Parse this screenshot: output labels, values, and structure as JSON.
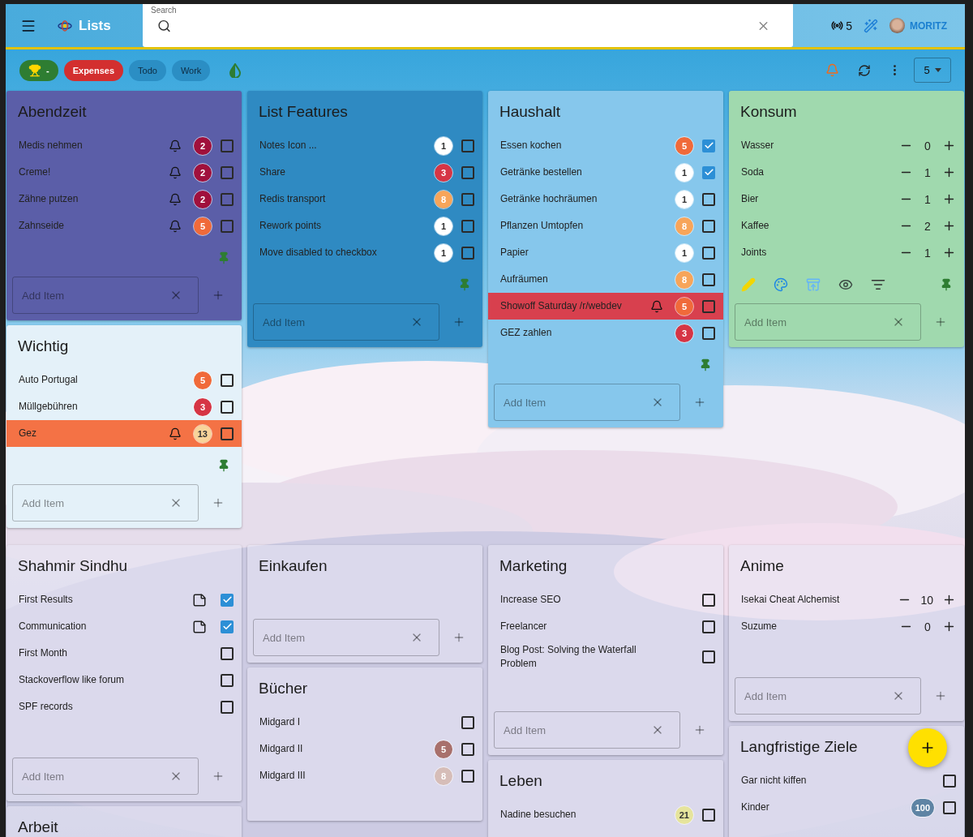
{
  "header": {
    "title": "Lists",
    "search": {
      "label": "Search"
    },
    "connections": "5",
    "user": "MORITZ"
  },
  "filters": [
    {
      "kind": "trophy",
      "label": "-",
      "color": "#2e7d32"
    },
    {
      "kind": "label",
      "label": "Expenses",
      "color": "#d32f2f"
    },
    {
      "kind": "label",
      "label": "Todo",
      "color": "#2b8ec4"
    },
    {
      "kind": "label",
      "label": "Work",
      "color": "#2b8ec4"
    },
    {
      "kind": "theme"
    }
  ],
  "toolbar": {
    "notifications": true,
    "columns": "5"
  },
  "sections": [
    {
      "columns": [
        [
          {
            "title": "Abendzeit",
            "color": "#5b5ea8",
            "pinned": true,
            "add_placeholder": "Add Item",
            "items": [
              {
                "kind": "check",
                "text": "Medis nehmen",
                "done": false,
                "bell": true,
                "badge": {
                  "text": "2",
                  "color": "#a0103c"
                }
              },
              {
                "kind": "check",
                "text": "Creme!",
                "done": false,
                "bell": true,
                "badge": {
                  "text": "2",
                  "color": "#a0103c"
                }
              },
              {
                "kind": "check",
                "text": "Zähne putzen",
                "done": false,
                "bell": true,
                "badge": {
                  "text": "2",
                  "color": "#a0103c"
                }
              },
              {
                "kind": "check",
                "text": "Zahnseide",
                "done": false,
                "bell": true,
                "badge": {
                  "text": "5",
                  "color": "#f06a3a"
                }
              }
            ]
          },
          {
            "title": "Wichtig",
            "color": "#e4f1f9",
            "pinned": true,
            "add_placeholder": "Add Item",
            "items": [
              {
                "kind": "check",
                "text": "Auto Portugal",
                "done": false,
                "badge": {
                  "text": "5",
                  "color": "#f06a3a"
                }
              },
              {
                "kind": "check",
                "text": "Müllgebühren",
                "done": false,
                "badge": {
                  "text": "3",
                  "color": "#d63545"
                }
              },
              {
                "kind": "check",
                "text": "Gez",
                "done": false,
                "bell": true,
                "color": "#f47245",
                "badge": {
                  "text": "13",
                  "color": "#f8d49a"
                }
              }
            ]
          }
        ],
        [
          {
            "title": "List Features",
            "color": "#2f8ac2",
            "pinned": true,
            "add_placeholder": "Add Item",
            "items": [
              {
                "kind": "check",
                "text": "Notes Icon ...",
                "done": false,
                "badge": {
                  "text": "1",
                  "color": "#ffffff"
                }
              },
              {
                "kind": "check",
                "text": "Share",
                "done": false,
                "badge": {
                  "text": "3",
                  "color": "#d63545"
                }
              },
              {
                "kind": "check",
                "text": "Redis transport",
                "done": false,
                "badge": {
                  "text": "8",
                  "color": "#f7a55a"
                }
              },
              {
                "kind": "check",
                "text": "Rework points",
                "done": false,
                "badge": {
                  "text": "1",
                  "color": "#ffffff"
                }
              },
              {
                "kind": "check",
                "text": "Move disabled to checkbox",
                "done": false,
                "badge": {
                  "text": "1",
                  "color": "#ffffff"
                }
              }
            ]
          }
        ],
        [
          {
            "title": "Haushalt",
            "color": "#86c7ec",
            "pinned": true,
            "add_placeholder": "Add Item",
            "items": [
              {
                "kind": "check",
                "text": "Essen kochen",
                "done": true,
                "badge": {
                  "text": "5",
                  "color": "#f06a3a"
                }
              },
              {
                "kind": "check",
                "text": "Getränke bestellen",
                "done": true,
                "badge": {
                  "text": "1",
                  "color": "#ffffff"
                }
              },
              {
                "kind": "check",
                "text": "Getränke hochräumen",
                "done": false,
                "badge": {
                  "text": "1",
                  "color": "#ffffff"
                }
              },
              {
                "kind": "check",
                "text": "Pflanzen Umtopfen",
                "done": false,
                "badge": {
                  "text": "8",
                  "color": "#f7a55a"
                }
              },
              {
                "kind": "check",
                "text": "Papier",
                "done": false,
                "badge": {
                  "text": "1",
                  "color": "#ffffff"
                }
              },
              {
                "kind": "check",
                "text": "Aufräumen",
                "done": false,
                "badge": {
                  "text": "8",
                  "color": "#f7a55a"
                }
              },
              {
                "kind": "check",
                "text": "Showoff Saturday /r/webdev",
                "done": false,
                "bell": true,
                "color": "#d8404e",
                "badge": {
                  "text": "5",
                  "color": "#f06a3a"
                }
              },
              {
                "kind": "check",
                "text": "GEZ zahlen",
                "done": false,
                "badge": {
                  "text": "3",
                  "color": "#d63545"
                }
              }
            ]
          }
        ],
        [
          {
            "title": "Konsum",
            "color": "#a0d9ae",
            "pinned": true,
            "toolbar": true,
            "add_placeholder": "Add Item",
            "items": [
              {
                "kind": "counter",
                "text": "Wasser",
                "count": "0"
              },
              {
                "kind": "counter",
                "text": "Soda",
                "count": "1"
              },
              {
                "kind": "counter",
                "text": "Bier",
                "count": "1"
              },
              {
                "kind": "counter",
                "text": "Kaffee",
                "count": "2"
              },
              {
                "kind": "counter",
                "text": "Joints",
                "count": "1"
              }
            ]
          }
        ]
      ]
    },
    {
      "columns": [
        [
          {
            "title": "Shahmir Sindhu",
            "add_placeholder": "Add Item",
            "items": [
              {
                "kind": "check",
                "text": "First Results",
                "done": true,
                "note": true
              },
              {
                "kind": "check",
                "text": "Communication",
                "done": true,
                "note": true
              },
              {
                "kind": "check",
                "text": "First Month",
                "done": false
              },
              {
                "kind": "check",
                "text": "Stackoverflow like forum",
                "done": false
              },
              {
                "kind": "check",
                "text": "SPF records",
                "done": false
              }
            ]
          },
          {
            "title": "Arbeit"
          }
        ],
        [
          {
            "title": "Einkaufen",
            "add_placeholder": "Add Item"
          },
          {
            "title": "Bücher",
            "items": [
              {
                "kind": "check",
                "text": "Midgard I",
                "done": false
              },
              {
                "kind": "check",
                "text": "Midgard II",
                "done": false,
                "badge": {
                  "text": "5",
                  "color": "#a8706c"
                }
              },
              {
                "kind": "check",
                "text": "Midgard III",
                "done": false,
                "badge": {
                  "text": "8",
                  "color": "#d6bdb8"
                }
              }
            ]
          }
        ],
        [
          {
            "title": "Marketing",
            "add_placeholder": "Add Item",
            "items": [
              {
                "kind": "check",
                "text": "Increase SEO",
                "done": false
              },
              {
                "kind": "check",
                "text": "Freelancer",
                "done": false
              },
              {
                "kind": "check",
                "text": "Blog Post: Solving the Waterfall Problem",
                "done": false
              }
            ]
          },
          {
            "title": "Leben",
            "items": [
              {
                "kind": "check",
                "text": "Nadine besuchen",
                "done": false,
                "badge": {
                  "text": "21",
                  "color": "#e6e49c"
                }
              }
            ]
          }
        ],
        [
          {
            "title": "Anime",
            "add_placeholder": "Add Item",
            "items": [
              {
                "kind": "counter",
                "text": "Isekai Cheat Alchemist",
                "count": "10"
              },
              {
                "kind": "counter",
                "text": "Suzume",
                "count": "0"
              }
            ]
          },
          {
            "title": "Langfristige Ziele",
            "items": [
              {
                "kind": "check",
                "text": "Gar nicht kiffen",
                "done": false
              },
              {
                "kind": "check",
                "text": "Kinder",
                "done": false,
                "badge": {
                  "text": "100",
                  "color": "#5e84a4"
                }
              }
            ]
          }
        ]
      ]
    }
  ]
}
